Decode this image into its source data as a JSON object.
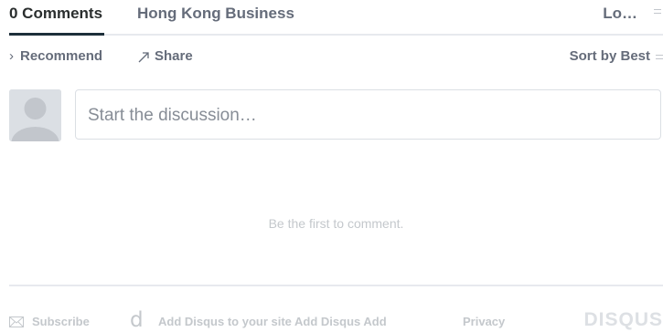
{
  "tabs": {
    "comments_label": "0 Comments",
    "site_label": "Hong Kong Business",
    "login_label": "Lo…"
  },
  "actions": {
    "recommend_label": "Recommend",
    "share_label": "Share",
    "sort_label": "Sort by Best"
  },
  "composer": {
    "placeholder": "Start the discussion…"
  },
  "empty_state": {
    "message": "Be the first to comment."
  },
  "footer": {
    "subscribe_label": "Subscribe",
    "d_glyph": "d",
    "add_disqus_label": "Add Disqus to your site Add Disqus Add",
    "privacy_label": "Privacy",
    "logo_text": "DISQUS"
  },
  "colors": {
    "text_dark": "#2a2e2e",
    "text_muted": "#656c7a",
    "text_faint": "#c4c8cc",
    "rule": "#e7e9ee"
  },
  "icons": [
    "chevron-right-icon",
    "share-arrow-icon",
    "menu-caret-icon",
    "avatar-icon",
    "envelope-icon",
    "disqus-d-icon"
  ]
}
